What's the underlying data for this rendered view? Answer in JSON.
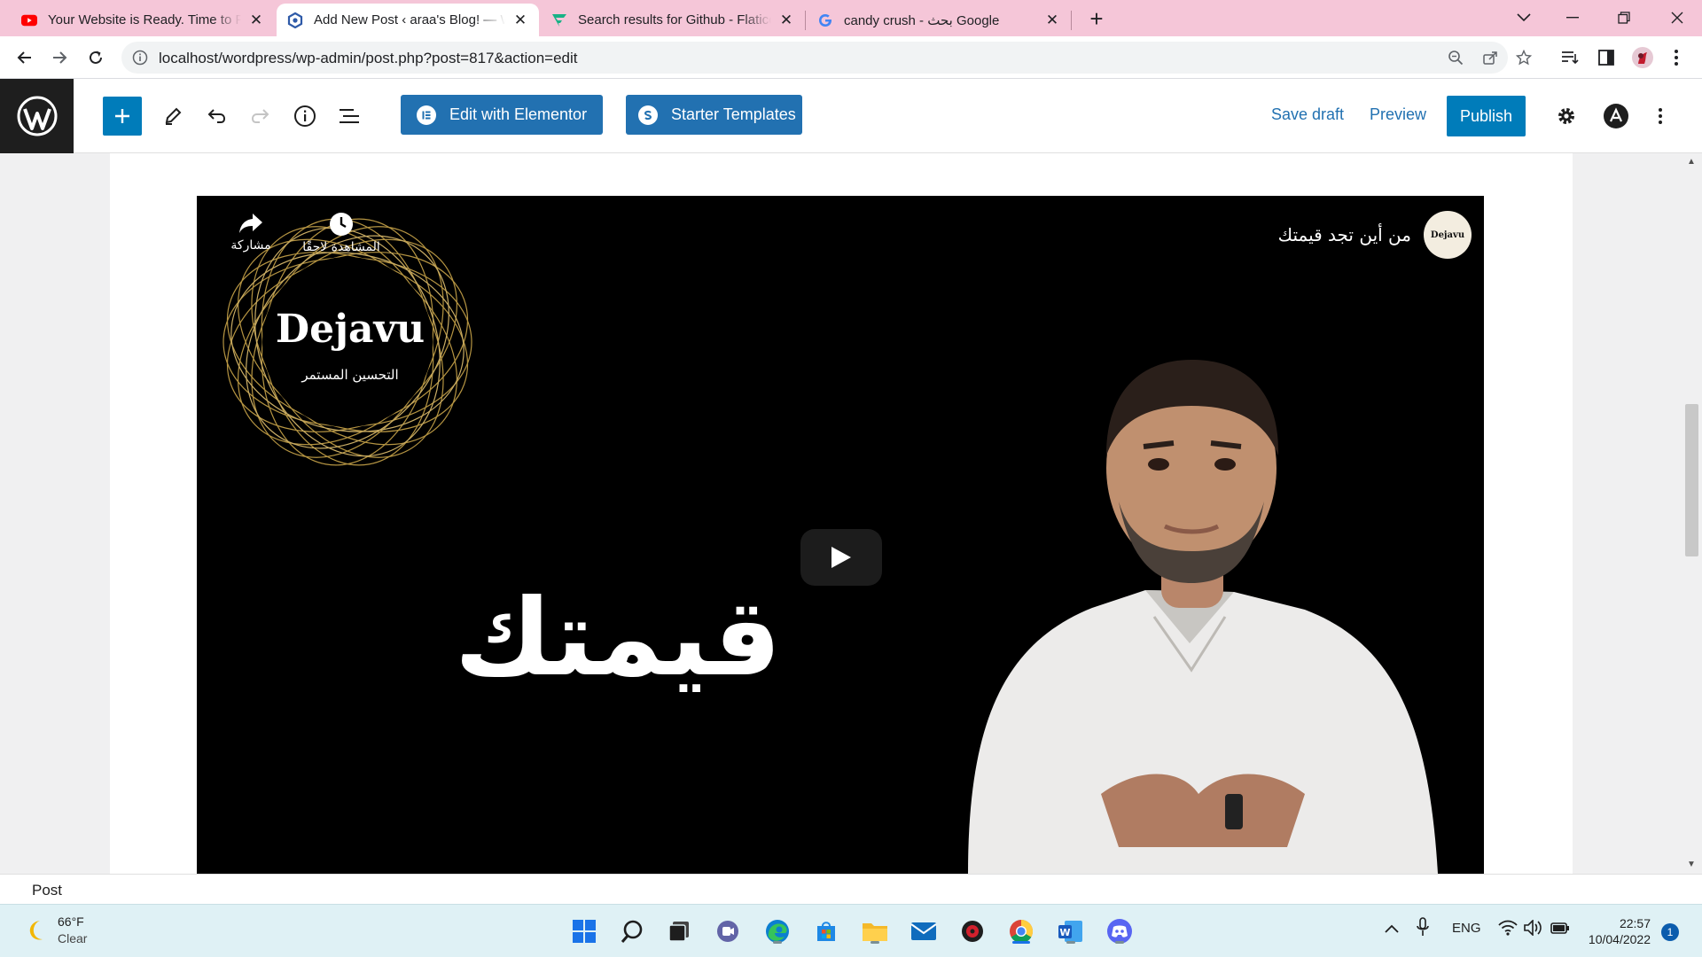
{
  "browser": {
    "tabs": [
      {
        "title": "Your Website is Ready. Time to Publish",
        "favicon": "youtube-icon",
        "active": false
      },
      {
        "title": "Add New Post ‹ araa's Blog! — WordPress",
        "favicon": "wordpress-site-icon",
        "active": true
      },
      {
        "title": "Search results for Github - Flaticon",
        "favicon": "flaticon-icon",
        "active": false
      },
      {
        "title": "candy crush - بحث Google",
        "favicon": "google-icon",
        "active": false
      }
    ],
    "new_tab_label": "+",
    "url": "localhost/wordpress/wp-admin/post.php?post=817&action=edit",
    "colors": {
      "tab_strip": "#f5c6d8",
      "active_tab": "#ffffff"
    }
  },
  "editor": {
    "toolbar": {
      "edit_with_elementor": "Edit with Elementor",
      "starter_templates": "Starter Templates",
      "save_draft": "Save draft",
      "preview": "Preview",
      "publish": "Publish"
    },
    "colors": {
      "accent": "#007cba",
      "button": "#2271b1",
      "logo_bg": "#1e1e1e"
    }
  },
  "video": {
    "title": "من أين تجد قيمتك",
    "channel_avatar_text": "Dejavu",
    "share_label": "مشاركة",
    "watch_later_label": "المشاهدة لاحقًا",
    "logo_name": "Dejavu",
    "logo_tagline": "التحسين المستمر",
    "overlay_word": "قيمتك"
  },
  "footer": {
    "breadcrumb": "Post"
  },
  "taskbar": {
    "weather_temp": "66°F",
    "weather_desc": "Clear",
    "language": "ENG",
    "time": "22:57",
    "date": "10/04/2022",
    "notification_count": "1"
  }
}
